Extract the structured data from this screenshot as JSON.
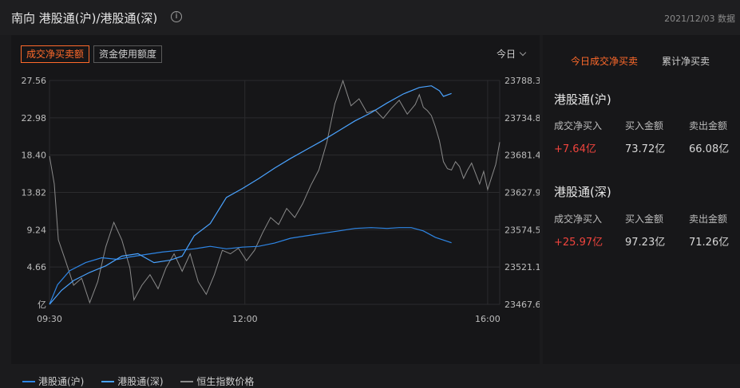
{
  "header": {
    "title": "南向 港股通(沪)/港股通(深)",
    "info_icon": "info-icon",
    "date_text": "2021/12/03 数据"
  },
  "chart_controls": {
    "buttons": [
      "成交净买卖额",
      "资金使用额度"
    ],
    "active_index": 0,
    "period_label": "今日"
  },
  "chart_data": {
    "type": "line",
    "x_ticks": [
      "09:30",
      "12:00",
      "16:00"
    ],
    "left_axis": {
      "ticks": [
        27.56,
        22.98,
        18.4,
        13.82,
        9.24,
        4.66
      ],
      "bottom_label": "亿",
      "range": [
        0.08,
        27.56
      ]
    },
    "right_axis": {
      "ticks": [
        23788.3,
        23734.8,
        23681.4,
        23627.9,
        23574.5,
        23521.1,
        23467.6
      ],
      "range": [
        23467.6,
        23788.3
      ]
    },
    "colors": {
      "hu": "#2e86e6",
      "shen": "#4aa3ff",
      "index": "#8a8a8a"
    },
    "series": [
      {
        "name": "港股通(沪)",
        "axis": "left",
        "points": [
          [
            0,
            0.08
          ],
          [
            0.02,
            2.5
          ],
          [
            0.05,
            4.2
          ],
          [
            0.09,
            5.2
          ],
          [
            0.13,
            5.8
          ],
          [
            0.17,
            5.6
          ],
          [
            0.2,
            5.9
          ],
          [
            0.24,
            6.2
          ],
          [
            0.28,
            6.5
          ],
          [
            0.32,
            6.7
          ],
          [
            0.36,
            6.9
          ],
          [
            0.4,
            7.2
          ],
          [
            0.44,
            6.9
          ],
          [
            0.48,
            7.1
          ],
          [
            0.52,
            7.2
          ],
          [
            0.56,
            7.6
          ],
          [
            0.6,
            8.2
          ],
          [
            0.64,
            8.5
          ],
          [
            0.68,
            8.8
          ],
          [
            0.72,
            9.1
          ],
          [
            0.76,
            9.4
          ],
          [
            0.8,
            9.5
          ],
          [
            0.84,
            9.4
          ],
          [
            0.87,
            9.5
          ],
          [
            0.9,
            9.5
          ],
          [
            0.93,
            9.1
          ],
          [
            0.96,
            8.3
          ],
          [
            1.0,
            7.64
          ]
        ]
      },
      {
        "name": "港股通(深)",
        "axis": "left",
        "points": [
          [
            0,
            0.08
          ],
          [
            0.03,
            1.8
          ],
          [
            0.06,
            3.0
          ],
          [
            0.1,
            4.0
          ],
          [
            0.14,
            4.8
          ],
          [
            0.18,
            6.0
          ],
          [
            0.22,
            6.3
          ],
          [
            0.26,
            5.2
          ],
          [
            0.3,
            5.5
          ],
          [
            0.33,
            6.0
          ],
          [
            0.36,
            8.5
          ],
          [
            0.4,
            10.0
          ],
          [
            0.44,
            13.2
          ],
          [
            0.48,
            14.3
          ],
          [
            0.52,
            15.5
          ],
          [
            0.56,
            16.8
          ],
          [
            0.6,
            18.0
          ],
          [
            0.64,
            19.1
          ],
          [
            0.68,
            20.2
          ],
          [
            0.72,
            21.4
          ],
          [
            0.76,
            22.6
          ],
          [
            0.8,
            23.6
          ],
          [
            0.84,
            24.8
          ],
          [
            0.88,
            25.9
          ],
          [
            0.92,
            26.7
          ],
          [
            0.95,
            26.9
          ],
          [
            0.97,
            26.3
          ],
          [
            0.98,
            25.6
          ],
          [
            1.0,
            25.97
          ]
        ]
      },
      {
        "name": "恒生指数价格",
        "axis": "right",
        "points": [
          [
            0,
            23680
          ],
          [
            0.012,
            23640
          ],
          [
            0.022,
            23560
          ],
          [
            0.04,
            23530
          ],
          [
            0.06,
            23495
          ],
          [
            0.08,
            23505
          ],
          [
            0.1,
            23470
          ],
          [
            0.12,
            23500
          ],
          [
            0.14,
            23550
          ],
          [
            0.16,
            23585
          ],
          [
            0.18,
            23560
          ],
          [
            0.2,
            23520
          ],
          [
            0.21,
            23474
          ],
          [
            0.23,
            23495
          ],
          [
            0.25,
            23510
          ],
          [
            0.27,
            23490
          ],
          [
            0.29,
            23520
          ],
          [
            0.31,
            23540
          ],
          [
            0.33,
            23515
          ],
          [
            0.35,
            23540
          ],
          [
            0.37,
            23500
          ],
          [
            0.39,
            23482
          ],
          [
            0.41,
            23510
          ],
          [
            0.43,
            23545
          ],
          [
            0.45,
            23540
          ],
          [
            0.47,
            23548
          ],
          [
            0.49,
            23530
          ],
          [
            0.51,
            23545
          ],
          [
            0.53,
            23570
          ],
          [
            0.55,
            23592
          ],
          [
            0.57,
            23582
          ],
          [
            0.59,
            23605
          ],
          [
            0.61,
            23592
          ],
          [
            0.63,
            23612
          ],
          [
            0.65,
            23638
          ],
          [
            0.67,
            23660
          ],
          [
            0.69,
            23700
          ],
          [
            0.71,
            23755
          ],
          [
            0.73,
            23788
          ],
          [
            0.75,
            23752
          ],
          [
            0.77,
            23762
          ],
          [
            0.79,
            23742
          ],
          [
            0.81,
            23746
          ],
          [
            0.83,
            23734
          ],
          [
            0.85,
            23748
          ],
          [
            0.87,
            23760
          ],
          [
            0.89,
            23740
          ],
          [
            0.91,
            23754
          ],
          [
            0.92,
            23768
          ],
          [
            0.93,
            23750
          ],
          [
            0.94,
            23745
          ],
          [
            0.95,
            23738
          ],
          [
            0.96,
            23722
          ],
          [
            0.97,
            23702
          ],
          [
            0.98,
            23672
          ],
          [
            0.99,
            23662
          ],
          [
            1.0,
            23660
          ],
          [
            1.01,
            23672
          ],
          [
            1.02,
            23665
          ],
          [
            1.03,
            23648
          ],
          [
            1.04,
            23660
          ],
          [
            1.05,
            23670
          ],
          [
            1.06,
            23655
          ],
          [
            1.07,
            23640
          ],
          [
            1.08,
            23658
          ],
          [
            1.09,
            23632
          ],
          [
            1.1,
            23650
          ],
          [
            1.11,
            23668
          ],
          [
            1.12,
            23700
          ]
        ]
      }
    ]
  },
  "legend": [
    {
      "label": "港股通(沪)",
      "color": "#2e86e6"
    },
    {
      "label": "港股通(深)",
      "color": "#4aa3ff"
    },
    {
      "label": "恒生指数价格",
      "color": "#8a8a8a"
    }
  ],
  "right_panel": {
    "tabs": [
      "今日成交净买卖",
      "累计净买卖"
    ],
    "active_tab": 0,
    "sections": [
      {
        "title": "港股通(沪)",
        "headers": [
          "成交净买入",
          "买入金额",
          "卖出金额"
        ],
        "values": [
          "+7.64亿",
          "73.72亿",
          "66.08亿"
        ]
      },
      {
        "title": "港股通(深)",
        "headers": [
          "成交净买入",
          "买入金额",
          "卖出金额"
        ],
        "values": [
          "+25.97亿",
          "97.23亿",
          "71.26亿"
        ]
      }
    ]
  }
}
